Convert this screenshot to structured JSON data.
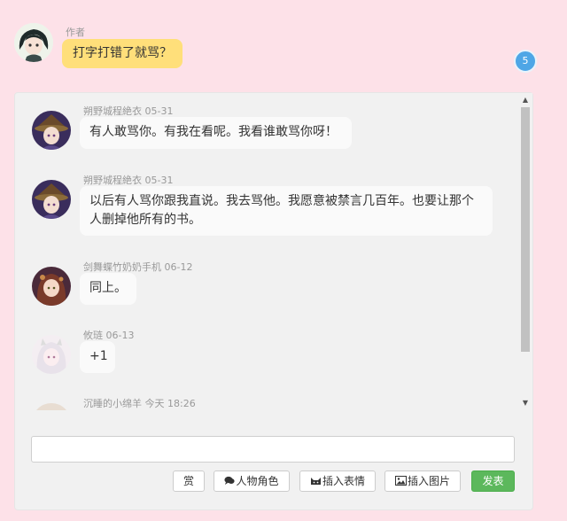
{
  "post": {
    "author_label": "作者",
    "content": "打字打错了就骂？",
    "reply_count": "5"
  },
  "replies": [
    {
      "name": "朔野城程絶衣",
      "date": "05-31",
      "text": "有人敢骂你。有我在看呢。我看谁敢骂你呀！"
    },
    {
      "name": "朔野城程絶衣",
      "date": "05-31",
      "text": "以后有人骂你跟我直说。我去骂他。我愿意被禁言几百年。也要让那个人删掉他所有的书。"
    },
    {
      "name": "剑舞蝶竹奶奶手机",
      "date": "06-12",
      "text": "同上。"
    },
    {
      "name": "攸琏",
      "date": "06-13",
      "text": "+1"
    },
    {
      "name": "沉睡的小绵羊",
      "date": "今天 18:26",
      "text": ""
    }
  ],
  "composer": {
    "input_value": "",
    "reward_label": "赏",
    "character_label": "人物角色",
    "emoji_label": "插入表情",
    "image_label": "插入图片",
    "send_label": "发表"
  },
  "colors": {
    "page_bg": "#fde1e8",
    "author_bubble": "#ffdf7a",
    "badge": "#4ea6e6",
    "send": "#5cb85c"
  },
  "icons": [
    "comment-icon",
    "cat-icon",
    "picture-icon",
    "scroll-up-icon",
    "scroll-down-icon"
  ]
}
